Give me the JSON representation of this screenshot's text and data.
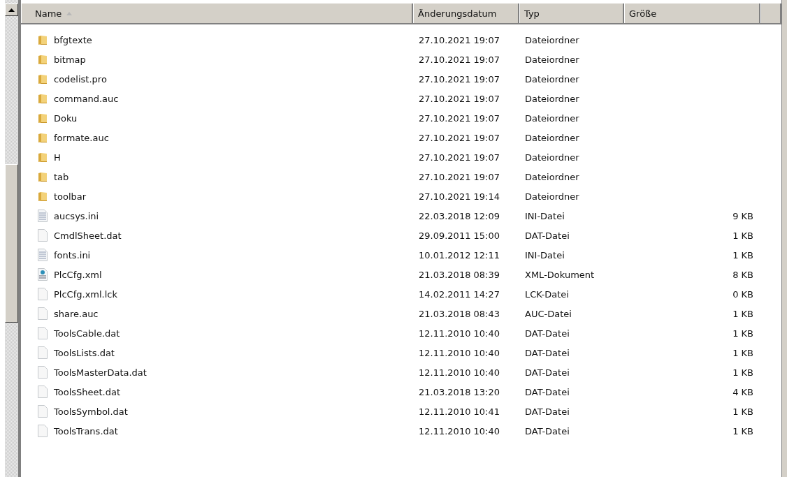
{
  "columns": [
    {
      "label": "Name",
      "sorted": true
    },
    {
      "label": "Änderungsdatum",
      "sorted": false
    },
    {
      "label": "Typ",
      "sorted": false
    },
    {
      "label": "Größe",
      "sorted": false
    }
  ],
  "rows": [
    {
      "kind": "folder",
      "name": "bfgtexte",
      "date": "27.10.2021 19:07",
      "type": "Dateiordner"
    },
    {
      "kind": "folder",
      "name": "bitmap",
      "date": "27.10.2021 19:07",
      "type": "Dateiordner"
    },
    {
      "kind": "folder",
      "name": "codelist.pro",
      "date": "27.10.2021 19:07",
      "type": "Dateiordner"
    },
    {
      "kind": "folder",
      "name": "command.auc",
      "date": "27.10.2021 19:07",
      "type": "Dateiordner"
    },
    {
      "kind": "folder",
      "name": "Doku",
      "date": "27.10.2021 19:07",
      "type": "Dateiordner"
    },
    {
      "kind": "folder",
      "name": "formate.auc",
      "date": "27.10.2021 19:07",
      "type": "Dateiordner"
    },
    {
      "kind": "folder",
      "name": "H",
      "date": "27.10.2021 19:07",
      "type": "Dateiordner"
    },
    {
      "kind": "folder",
      "name": "tab",
      "date": "27.10.2021 19:07",
      "type": "Dateiordner"
    },
    {
      "kind": "folder",
      "name": "toolbar",
      "date": "27.10.2021 19:14",
      "type": "Dateiordner"
    },
    {
      "kind": "text",
      "name": "aucsys.ini",
      "date": "22.03.2018 12:09",
      "type": "INI-Datei",
      "size": "9 KB"
    },
    {
      "kind": "file",
      "name": "CmdlSheet.dat",
      "date": "29.09.2011 15:00",
      "type": "DAT-Datei",
      "size": "1 KB"
    },
    {
      "kind": "text",
      "name": "fonts.ini",
      "date": "10.01.2012 12:11",
      "type": "INI-Datei",
      "size": "1 KB"
    },
    {
      "kind": "xml",
      "name": "PlcCfg.xml",
      "date": "21.03.2018 08:39",
      "type": "XML-Dokument",
      "size": "8 KB"
    },
    {
      "kind": "file",
      "name": "PlcCfg.xml.lck",
      "date": "14.02.2011 14:27",
      "type": "LCK-Datei",
      "size": "0 KB"
    },
    {
      "kind": "file",
      "name": "share.auc",
      "date": "21.03.2018 08:43",
      "type": "AUC-Datei",
      "size": "1 KB"
    },
    {
      "kind": "file",
      "name": "ToolsCable.dat",
      "date": "12.11.2010 10:40",
      "type": "DAT-Datei",
      "size": "1 KB"
    },
    {
      "kind": "file",
      "name": "ToolsLists.dat",
      "date": "12.11.2010 10:40",
      "type": "DAT-Datei",
      "size": "1 KB"
    },
    {
      "kind": "file",
      "name": "ToolsMasterData.dat",
      "date": "12.11.2010 10:40",
      "type": "DAT-Datei",
      "size": "1 KB"
    },
    {
      "kind": "file",
      "name": "ToolsSheet.dat",
      "date": "21.03.2018 13:20",
      "type": "DAT-Datei",
      "size": "4 KB"
    },
    {
      "kind": "file",
      "name": "ToolsSymbol.dat",
      "date": "12.11.2010 10:41",
      "type": "DAT-Datei",
      "size": "1 KB"
    },
    {
      "kind": "file",
      "name": "ToolsTrans.dat",
      "date": "12.11.2010 10:40",
      "type": "DAT-Datei",
      "size": "1 KB"
    }
  ]
}
